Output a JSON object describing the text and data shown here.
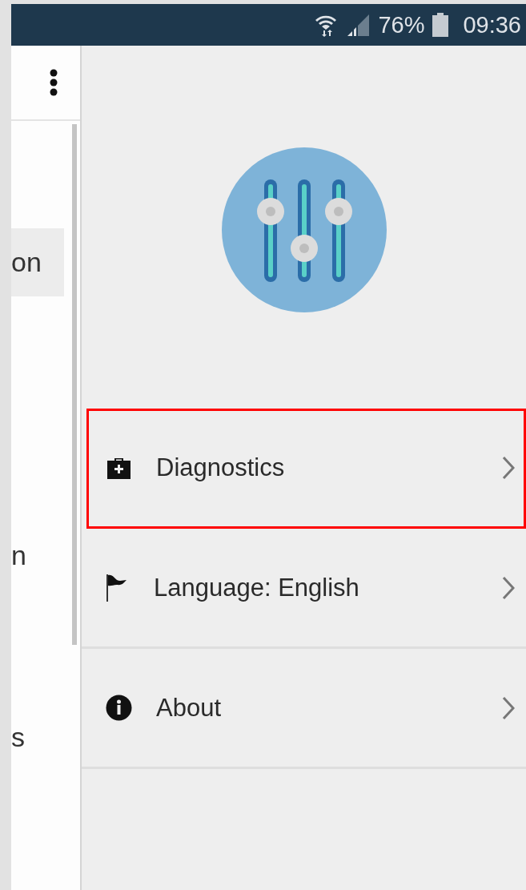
{
  "status_bar": {
    "battery": "76%",
    "time": "09:36"
  },
  "left_panel": {
    "items": [
      {
        "label": "on",
        "selected": true
      },
      {
        "label": "n",
        "selected": false
      },
      {
        "label": "s",
        "selected": false
      }
    ]
  },
  "menu": [
    {
      "kind": "diagnostics",
      "label": "Diagnostics",
      "highlighted": true
    },
    {
      "kind": "language",
      "label": "Language: English",
      "highlighted": false
    },
    {
      "kind": "about",
      "label": "About",
      "highlighted": false
    }
  ]
}
